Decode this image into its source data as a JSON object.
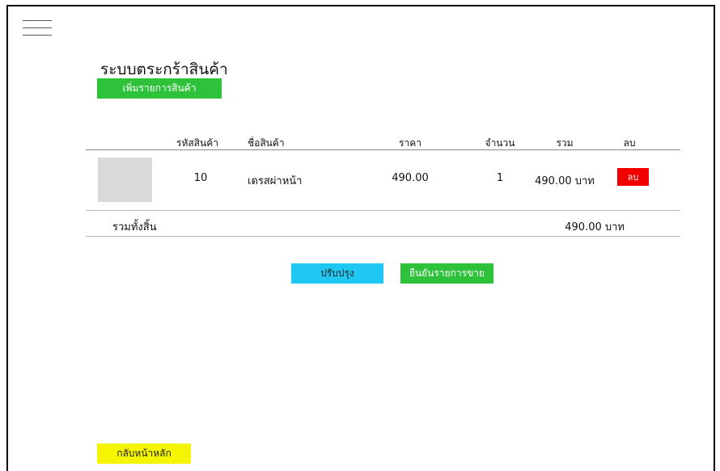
{
  "header": {
    "title": "ระบบตระกร้าสินค้า",
    "add_button": "เพิ่มรายการสินค้า"
  },
  "table": {
    "columns": {
      "code": "รหัสสินค้า",
      "name": "ชื่อสินค้า",
      "price": "ราคา",
      "qty": "จำนวน",
      "sum": "รวม",
      "delete": "ลบ"
    },
    "rows": [
      {
        "code": "10",
        "name": "เดรสผ่าหน้า",
        "price": "490.00",
        "qty": "1",
        "sum": "490.00 บาท",
        "delete_label": "ลบ"
      }
    ],
    "total_label": "รวมทั้งสิ้น",
    "total_value": "490.00 บาท"
  },
  "actions": {
    "update": "ปรับปรุง",
    "confirm": "ยืนยันรายการขาย",
    "home": "กลับหน้าหลัก"
  },
  "colors": {
    "add": "#2ec13a",
    "update": "#1ec8f2",
    "confirm": "#2ec13a",
    "home": "#f5f500",
    "delete": "#f20000"
  },
  "icons": {
    "menu": "hamburger-menu-icon"
  }
}
